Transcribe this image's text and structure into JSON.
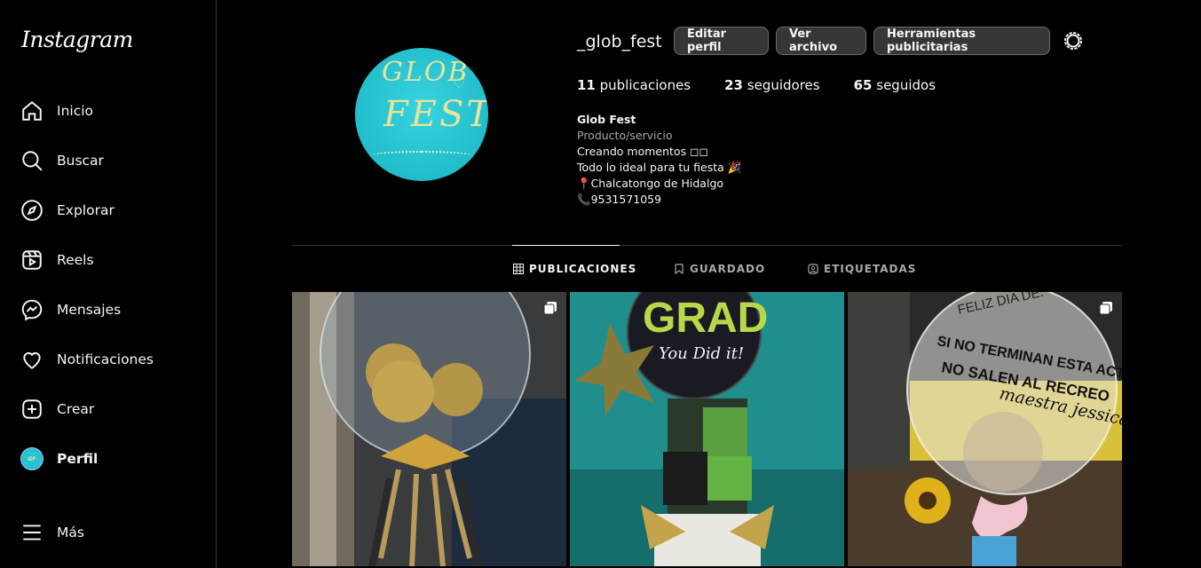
{
  "app": {
    "logo": "Instagram"
  },
  "nav": [
    {
      "label": "Inicio",
      "icon": "home-icon"
    },
    {
      "label": "Buscar",
      "icon": "search-icon"
    },
    {
      "label": "Explorar",
      "icon": "compass-icon"
    },
    {
      "label": "Reels",
      "icon": "reels-icon"
    },
    {
      "label": "Mensajes",
      "icon": "messenger-icon"
    },
    {
      "label": "Notificaciones",
      "icon": "heart-icon"
    },
    {
      "label": "Crear",
      "icon": "plus-square-icon"
    },
    {
      "label": "Perfil",
      "icon": "profile-avatar"
    },
    {
      "label": "Más",
      "icon": "menu-icon"
    }
  ],
  "profile": {
    "username": "_glob_fest",
    "avatar_text_1": "GLOB",
    "avatar_text_2": "FEST",
    "buttons": {
      "edit": "Editar perfil",
      "archive": "Ver archivo",
      "ads": "Herramientas publicitarias"
    },
    "stats": {
      "posts_count": "11",
      "posts_label": "publicaciones",
      "followers_count": "23",
      "followers_label": "seguidores",
      "following_count": "65",
      "following_label": "seguidos"
    },
    "bio": {
      "name": "Glob Fest",
      "category": "Producto/servicio",
      "line1": "Creando momentos ◻◻",
      "line2": "Todo lo ideal para tu fiesta 🎉",
      "line3": "📍Chalcatongo de Hidalgo",
      "line4": "📞9531571059"
    }
  },
  "tabs": [
    {
      "label": "PUBLICACIONES",
      "icon": "grid-icon",
      "active": true
    },
    {
      "label": "GUARDADO",
      "icon": "bookmark-icon",
      "active": false
    },
    {
      "label": "ETIQUETADAS",
      "icon": "tagged-icon",
      "active": false
    }
  ],
  "posts": [
    {
      "text": "",
      "multi": true
    },
    {
      "text_top": "GRAD",
      "text_sub": "You Did it!",
      "multi": false
    },
    {
      "text_lines": [
        "FELIZ DIA DE:",
        "SI NO TERMINAN ESTA ACTI",
        "NO SALEN AL RECREO",
        "maestra jessica"
      ],
      "multi": true
    }
  ],
  "colors": {
    "bg": "#000000",
    "accent": "#21bdcb",
    "border": "#363636"
  }
}
